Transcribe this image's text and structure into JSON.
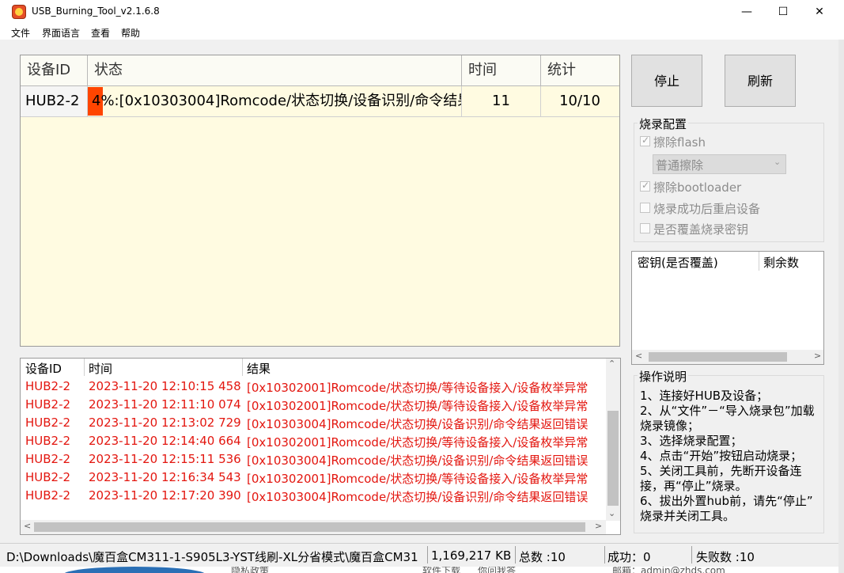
{
  "window": {
    "title": "USB_Burning_Tool_v2.1.6.8",
    "minimize": "—",
    "maximize": "☐",
    "close": "✕"
  },
  "menu": [
    "文件",
    "界面语言",
    "查看",
    "帮助"
  ],
  "device_table": {
    "headers": [
      "设备ID",
      "状态",
      "时间",
      "统计"
    ],
    "rows": [
      {
        "id": "HUB2-2",
        "progress_percent": 4,
        "status": "4%:[0x10303004]Romcode/状态切换/设备识别/命令结果",
        "time": "11",
        "count": "10/10"
      }
    ]
  },
  "buttons": {
    "stop": "停止",
    "refresh": "刷新"
  },
  "burn_config": {
    "title": "烧录配置",
    "erase_flash": "擦除flash",
    "erase_mode": "普通擦除",
    "erase_bootloader": "擦除bootloader",
    "reboot_after_success": "烧录成功后重启设备",
    "overwrite_key": "是否覆盖烧录密钥"
  },
  "key_table": {
    "headers": [
      "密钥(是否覆盖)",
      "剩余数"
    ]
  },
  "instructions": {
    "title": "操作说明",
    "lines": [
      "1、连接好HUB及设备；",
      "2、从“文件”－“导入烧录包”加载",
      "烧录镜像；",
      "3、选择烧录配置；",
      "4、点击“开始”按钮启动烧录；",
      "5、关闭工具前，先断开设备连",
      "接，再“停止”烧录。",
      "6、拔出外置hub前，请先“停止”",
      "烧录并关闭工具。"
    ]
  },
  "log": {
    "headers": [
      "设备ID",
      "时间",
      "结果"
    ],
    "rows": [
      [
        "HUB2-2",
        "2023-11-20 12:10:15 458",
        "[0x10302001]Romcode/状态切换/等待设备接入/设备枚举异常"
      ],
      [
        "HUB2-2",
        "2023-11-20 12:11:10 074",
        "[0x10302001]Romcode/状态切换/等待设备接入/设备枚举异常"
      ],
      [
        "HUB2-2",
        "2023-11-20 12:13:02 729",
        "[0x10303004]Romcode/状态切换/设备识别/命令结果返回错误"
      ],
      [
        "HUB2-2",
        "2023-11-20 12:14:40 664",
        "[0x10302001]Romcode/状态切换/等待设备接入/设备枚举异常"
      ],
      [
        "HUB2-2",
        "2023-11-20 12:15:11 536",
        "[0x10303004]Romcode/状态切换/设备识别/命令结果返回错误"
      ],
      [
        "HUB2-2",
        "2023-11-20 12:16:34 543",
        "[0x10302001]Romcode/状态切换/等待设备接入/设备枚举异常"
      ],
      [
        "HUB2-2",
        "2023-11-20 12:17:20 390",
        "[0x10303004]Romcode/状态切换/设备识别/命令结果返回错误"
      ]
    ]
  },
  "status_bar": {
    "path": "D:\\Downloads\\魔百盒CM311-1-S905L3-YST线刷-XL分省模式\\魔百盒CM31",
    "size": "1,169,217 KB",
    "total": "总数 :10",
    "success": "成功：0",
    "failed": "失败数 :10"
  },
  "background_page": [
    "隐私政策",
    "软件下载",
    "你问我答",
    "邮箱：admin@zhds.com"
  ],
  "colors": {
    "progress": "#ff4500",
    "log_error": "#e3160f",
    "table_bg": "#fffbe1"
  }
}
